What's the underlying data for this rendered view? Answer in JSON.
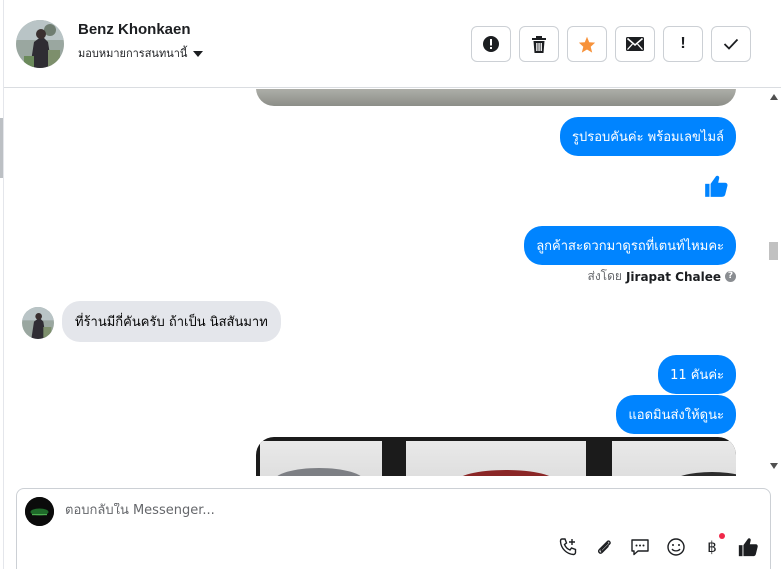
{
  "header": {
    "contact_name": "Benz Khonkaen",
    "assign_label": "มอบหมายการสนทนานี้",
    "actions": [
      {
        "icon": "alert-circle-icon"
      },
      {
        "icon": "trash-icon"
      },
      {
        "icon": "star-icon",
        "color": "#f7923a"
      },
      {
        "icon": "envelope-icon"
      },
      {
        "icon": "exclamation-icon",
        "text": "!"
      },
      {
        "icon": "check-icon"
      }
    ]
  },
  "messages": {
    "m1": "รูปรอบคันค่ะ พร้อมเลขไมล์",
    "m2": "ลูกค้าสะดวกมาดูรถที่เตนท์ไหมคะ",
    "sent_by_prefix": "ส่งโดย",
    "sent_by_name": "Jirapat Chalee",
    "sent_by_help": "?",
    "m3": "ที่ร้านมีกี่คันครับ ถ้าเป็น นิสสันมาท",
    "m4": "11 คันค่ะ",
    "m5": "แอดมินส่งให้ดูนะ"
  },
  "composer": {
    "placeholder": "ตอบกลับใน Messenger...",
    "baht_symbol": "฿"
  },
  "colors": {
    "accent": "#0084ff",
    "incoming_bubble": "#e4e6eb",
    "notification_dot": "#f02849"
  }
}
